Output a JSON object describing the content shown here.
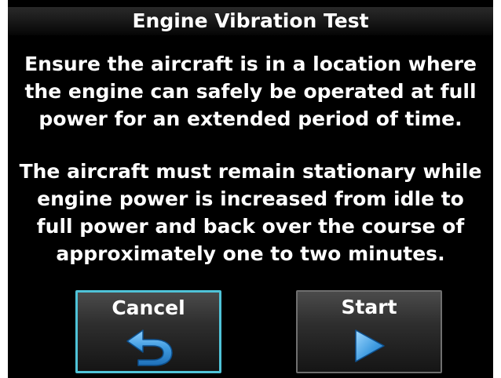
{
  "dialog": {
    "title": "Engine Vibration Test",
    "message_1": "Ensure the aircraft is in a location where\nthe engine can safely be operated at full\npower for an extended period of time.",
    "message_2": "The aircraft must remain stationary while\nengine power is increased from idle to\nfull power and back over the course of\napproximately one to two minutes."
  },
  "buttons": {
    "cancel": {
      "label": "Cancel",
      "icon": "return-arrow-icon"
    },
    "start": {
      "label": "Start",
      "icon": "play-triangle-icon"
    }
  },
  "colors": {
    "background": "#000000",
    "text": "#ffffff",
    "selected_border": "#4fc3d8",
    "icon_blue": "#4aa8e6"
  }
}
